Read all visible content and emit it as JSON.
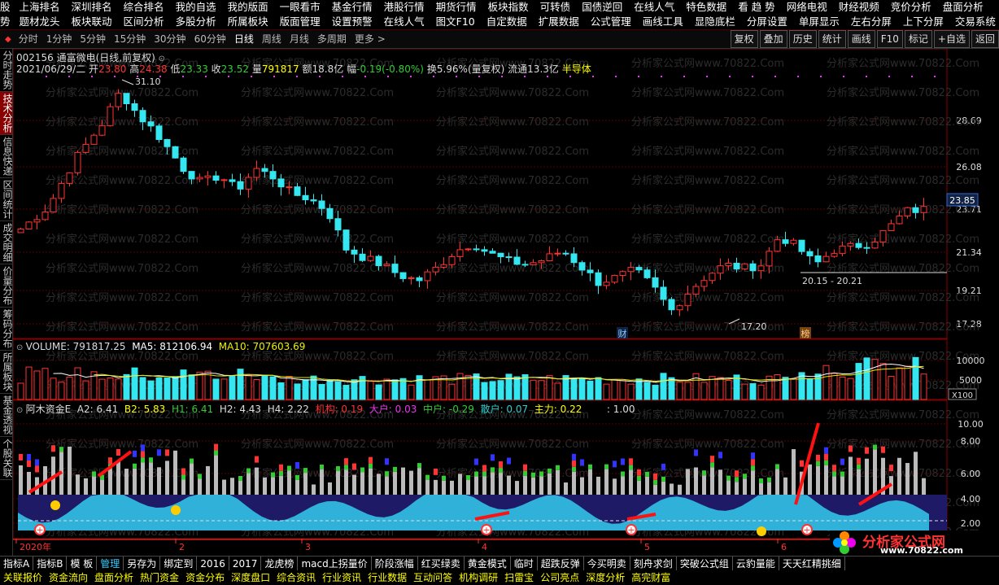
{
  "menu_row1": [
    "上海排名",
    "深圳排名",
    "综合排名",
    "我的自选",
    "我的版面",
    "一眼看市",
    "基金行情",
    "港股行情",
    "期货行情",
    "板块指数",
    "可转债",
    "国债逆回",
    "在线人气",
    "特色数据",
    "看 趋 势",
    "网络电视",
    "财经视频",
    "竞价分析",
    "盘面分析"
  ],
  "menu_row2": [
    "题材龙头",
    "板块联动",
    "区间分析",
    "多股分析",
    "所属板块",
    "版面管理",
    "设置预警",
    "在线人气",
    "图文F10",
    "自定数据",
    "扩展数据",
    "公式管理",
    "画线工具",
    "显隐底栏",
    "分屏设置",
    "单屏显示",
    "左右分屏",
    "上下分屏",
    "交易系统"
  ],
  "menu_left_stub": [
    "股",
    "势"
  ],
  "toolbar": {
    "periods": [
      "分时",
      "1分钟",
      "5分钟",
      "15分钟",
      "30分钟",
      "60分钟",
      "日线",
      "周线",
      "月线",
      "多周期",
      "更多 >"
    ],
    "active": "日线",
    "right_buttons": [
      "复权",
      "叠加",
      "历史",
      "统计",
      "画线",
      "F10",
      "标记",
      "+自选",
      "返回"
    ]
  },
  "sidebar": [
    {
      "label": "分时走势",
      "active": false
    },
    {
      "label": "技术分析",
      "active": true
    },
    {
      "label": "信息快递",
      "active": false
    },
    {
      "label": "区间统计",
      "active": false
    },
    {
      "label": "成交明细",
      "active": false
    },
    {
      "label": "价量分布",
      "active": false
    },
    {
      "label": "筹码分布",
      "active": false
    },
    {
      "label": "所属板块",
      "active": false
    },
    {
      "label": "基金透视",
      "active": false
    },
    {
      "label": "个股关联",
      "active": false
    }
  ],
  "header": {
    "title": "002156 通富微电(日线,前复权)",
    "date": "2021/06/29/二",
    "open_label": "开",
    "open": "23.80",
    "high_label": "高",
    "high": "24.38",
    "low_label": "低",
    "low": "23.33",
    "close_label": "收",
    "close": "23.52",
    "vol_label": "量",
    "vol": "791817",
    "amt_label": "额",
    "amt": "18.8亿",
    "chg_label": "幅",
    "chg": "-0.19(-0.80%)",
    "turn_label": "换",
    "turn": "5.96%(量复权)",
    "float_label": "流通",
    "float": "13.3亿",
    "sector": "半导体"
  },
  "annotations": {
    "high_mark": "31.10",
    "low_mark": "17.20",
    "range_label": "20.15 - 20.21",
    "price_tag": "23.85",
    "cai": "财",
    "bang": "榜"
  },
  "volume_header": {
    "label": "VOLUME: 791817.25",
    "ma5": "MA5: 812106.94",
    "ma10": "MA10: 707603.69",
    "unit": "X100"
  },
  "fund_header": {
    "name": "阿木资金E",
    "a2": "A2: 6.41",
    "b2": "B2: 5.83",
    "h1": "H1: 6.41",
    "h2": "H2: 4.43",
    "h4": "H4: 2.22",
    "jigou": "机构: 0.19",
    "dahu": "大户: 0.03",
    "zhonghu": "中户: -0.29",
    "sanhu": "散户: 0.07",
    "zhuli": "主力: 0.22",
    "extra": ": 1.00"
  },
  "axes": {
    "price_ticks": [
      "28.69",
      "26.08",
      "23.71",
      "21.34",
      "19.21",
      "17.28"
    ],
    "vol_ticks": [
      "10000",
      "5000"
    ],
    "fund_ticks": [
      "10.00",
      "8.00",
      "6.00",
      "4.00",
      "2.00"
    ],
    "x_ticks": [
      "2020年",
      "2",
      "3",
      "4",
      "5",
      "6"
    ]
  },
  "watermark": "分析家公式网www.70822.Com",
  "bottom_tabs": [
    "指标A",
    "指标B",
    "模 板",
    "管理",
    "另存为",
    "绑定到",
    "2016",
    "2017",
    "龙虎榜",
    "macd上拐量价",
    "阶段涨幅",
    "红买绿卖",
    "黄金模式",
    "临时",
    "超跌反弹",
    "今买明卖",
    "刻舟求剑",
    "突破公式组",
    "云豹量能",
    "天天红精挑细"
  ],
  "bottom_active": "管理",
  "bottom_row2": [
    "关联报价",
    "资金流向",
    "盘面分析",
    "热门资金",
    "资金分布",
    "深度盘口",
    "综合资讯",
    "行业资讯",
    "行业数据",
    "互动问答",
    "机构调研",
    "扫雷宝",
    "公司亮点",
    "深度分析",
    "高完财富"
  ],
  "logo_text": "分析家公式网",
  "logo_url": "www.70822.com",
  "colors": {
    "up": "#ff3333",
    "down": "#33e6f0",
    "bg": "#000000",
    "grid": "#5a0000",
    "ma5": "#ffffff",
    "ma10": "#e6e600"
  }
}
